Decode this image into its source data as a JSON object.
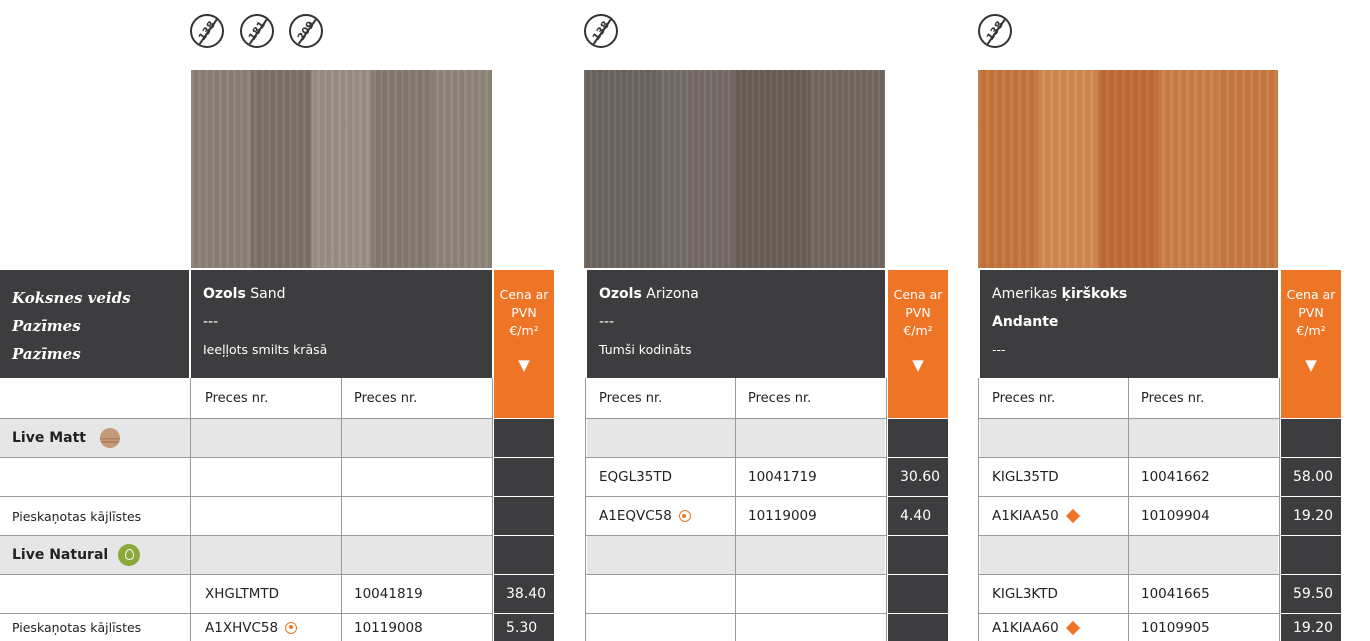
{
  "icons": {
    "col1": [
      "138",
      "181",
      "209"
    ],
    "col2": [
      "138"
    ],
    "col3": [
      "138"
    ]
  },
  "labels": [
    "Koksnes veids",
    "Pazīmes",
    "Pazīmes"
  ],
  "products": [
    {
      "name_bold": "Ozols",
      "name_rest": " Sand",
      "line2": "---",
      "line3": "Ieeļļots smilts krāsā"
    },
    {
      "name_bold": "Ozols",
      "name_rest": " Arizona",
      "line2": "---",
      "line3": "Tumši kodināts"
    },
    {
      "name_prefix": "Amerikas ",
      "name_bold": "ķirškoks",
      "line2": "Andante",
      "line3": "---"
    }
  ],
  "price_header": {
    "line1": "Cena ar",
    "line2": "PVN",
    "line3": "€/m²",
    "arrow": "▼"
  },
  "col_header": "Preces nr.",
  "sections": {
    "matt": "Live Matt",
    "natural": "Live Natural"
  },
  "rows": {
    "matt_1": {
      "label": "",
      "p2": {
        "code": "EQGL35TD",
        "nr": "10041719",
        "price": "30.60"
      },
      "p3": {
        "code": "KIGL35TD",
        "nr": "10041662",
        "price": "58.00"
      }
    },
    "matt_2": {
      "label": "Pieskaņotas kājlīstes",
      "p2": {
        "code": "A1EQVC58",
        "nr": "10119009",
        "price": "4.40"
      },
      "p3": {
        "code": "A1KIAA50",
        "nr": "10109904",
        "price": "19.20"
      }
    },
    "nat_1": {
      "label": "",
      "p1": {
        "code": "XHGLTMTD",
        "nr": "10041819",
        "price": "38.40"
      },
      "p3": {
        "code": "KIGL3KTD",
        "nr": "10041665",
        "price": "59.50"
      }
    },
    "nat_2": {
      "label": "Pieskaņotas kājlīstes",
      "p1": {
        "code": "A1XHVC58",
        "nr": "10119008",
        "price": "5.30"
      },
      "p3": {
        "code": "A1KIAA60",
        "nr": "10109905",
        "price": "19.20"
      }
    }
  },
  "colors": {
    "dark": "#3d3d3f",
    "orange": "#ee7526",
    "section_bg": "#e6e6e6",
    "natural_green": "#8ba83a"
  }
}
